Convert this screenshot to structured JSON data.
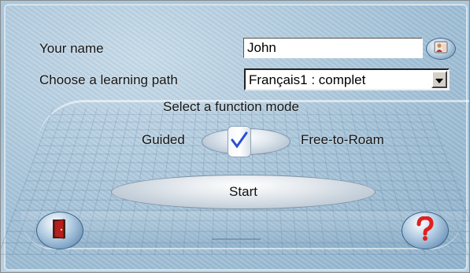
{
  "form": {
    "name_label": "Your name",
    "name_value": "John",
    "path_label": "Choose a learning path",
    "path_value": "Français1 : complet",
    "mode_title": "Select a function mode",
    "mode_guided": "Guided",
    "mode_free": "Free-to-Roam",
    "mode_selected": "Guided",
    "start_label": "Start"
  },
  "icons": {
    "user": "user-icon",
    "dropdown": "chevron-down-icon",
    "check": "check-icon",
    "exit": "door-exit-icon",
    "help": "question-mark-icon"
  },
  "colors": {
    "background": "#9cbfd8",
    "check": "#2a4fd6",
    "help": "#e02020",
    "door": "#b3201d"
  }
}
